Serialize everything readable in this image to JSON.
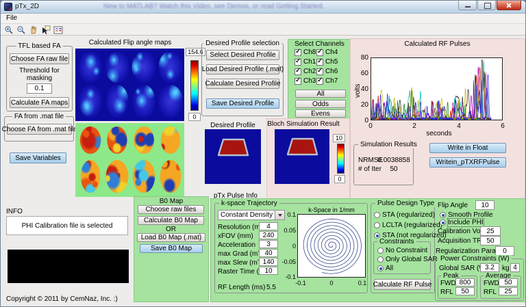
{
  "window": {
    "title": "pTx_2D",
    "watermark": "New to MATLAB? Watch this Video, see Demos, or read Getting Started."
  },
  "menu": {
    "file": "File"
  },
  "toolbar": {
    "icons": [
      "zoom-in",
      "zoom-out",
      "pan",
      "data-cursor",
      "legend"
    ]
  },
  "colors": {
    "panel_green": "#a5e39f",
    "panel_pink": "#f3e1df",
    "highlight_button_blue": "#aed3ee",
    "map_background_blue": "#0b0b9d",
    "phase_background_green": "#8de889",
    "profile_red": "#a81410",
    "titlebar_blue": "#cfdfee"
  },
  "left": {
    "tfl": {
      "legend": "TFL based FA",
      "choose_button": "Choose FA raw file",
      "threshold_label": "Threshold for masking",
      "threshold_value": "0.1",
      "calc_button": "Calculate FA maps"
    },
    "mat": {
      "legend": "FA from .mat file",
      "choose_button": "Choose FA from .mat file"
    },
    "save_button": "Save Variables",
    "info_label": "INFO",
    "info_text": "PHI Calibration file is selected",
    "copyright": "Copyright © 2011 by CemNaz, Inc. :)"
  },
  "flip_maps": {
    "title": "Calculated Flip angle maps",
    "cbar_max": "154.6",
    "cbar_min": "0"
  },
  "desired_selection": {
    "legend": "Desired Profile selection",
    "buttons": [
      "Select Desired Profile",
      "Load Desired Profile (.mat)",
      "Calculate Desired Profile"
    ],
    "save_button": "Save Desired Profile"
  },
  "channels": {
    "title": "Select Channels",
    "items": [
      {
        "label": "Ch8",
        "checked": true
      },
      {
        "label": "Ch4",
        "checked": true
      },
      {
        "label": "Ch1",
        "checked": true
      },
      {
        "label": "Ch5",
        "checked": true
      },
      {
        "label": "Ch2",
        "checked": true
      },
      {
        "label": "Ch6",
        "checked": true
      },
      {
        "label": "Ch3",
        "checked": true
      },
      {
        "label": "Ch7",
        "checked": true
      }
    ],
    "buttons": [
      "All",
      "Odds",
      "Evens"
    ]
  },
  "desired_profile": {
    "title": "Desired Profile"
  },
  "bloch": {
    "title": "Bloch Simulation Result",
    "cbar_max": "10",
    "cbar_min": "0"
  },
  "rf": {
    "title": "Calculated RF Pulses",
    "ylabel": "volts",
    "xlabel": "seconds",
    "yticks": [
      "80",
      "60",
      "40",
      "20",
      "0"
    ],
    "xticks": [
      "0",
      "2",
      "4",
      "6"
    ],
    "ylim": [
      0,
      80
    ],
    "xlim": [
      0,
      6
    ],
    "pulse_duration_s": 5.5,
    "series_colors": [
      "#00008f",
      "#c00000",
      "#007f00",
      "#00b8b8",
      "#b000b0",
      "#c8b400",
      "#303030",
      "#2828ff"
    ]
  },
  "sim_results": {
    "legend": "Simulation Results",
    "nrmse_label": "NRMSE",
    "nrmse_value": "0.0038858",
    "iter_label": "# of Iter",
    "iter_value": "50"
  },
  "write_buttons": {
    "float": "Write in Float",
    "ptx": "Writein_pTXRFPulse"
  },
  "b0": {
    "title": "B0 Map",
    "choose_button": "Choose raw files",
    "calc_button": "Calculate B0 Map",
    "or_label": "OR",
    "load_button": "Load B0 Map (.mat)",
    "save_button": "Save B0 Map"
  },
  "pulse_info": {
    "title": "pTx Pulse Info",
    "kspace": {
      "legend": "k-space Trajectory",
      "dropdown": "Constant Density Spiral",
      "params": [
        {
          "label": "Resolution (mm)",
          "value": "4"
        },
        {
          "label": "xFOV (mm)",
          "value": "240"
        },
        {
          "label": "Acceleration",
          "value": "3"
        },
        {
          "label": "max Grad (mT/m)",
          "value": "40"
        },
        {
          "label": "max Slew (mT/m/s)",
          "value": "140"
        },
        {
          "label": "Raster Time (us)",
          "value": "10"
        }
      ],
      "rf_length_label": "RF Length (ms)",
      "rf_length_value": "5.5",
      "plot_title": "k-Space in 1/mm",
      "yticks": [
        "0.1",
        "0.05",
        "0",
        "-0.05",
        "-0.1"
      ],
      "xticks": [
        "-0.1",
        "0",
        "0.1"
      ]
    },
    "design": {
      "legend": "Pulse Design Type",
      "options": [
        {
          "label": "STA (regularized)",
          "selected": false
        },
        {
          "label": "LCLTA (regularized)",
          "selected": false
        },
        {
          "label": "STA (not regularized)",
          "selected": true
        }
      ],
      "constraints_legend": "Constraints",
      "constraints": [
        {
          "label": "No Constraint",
          "selected": false
        },
        {
          "label": "Only Global SAR",
          "selected": false
        },
        {
          "label": "All",
          "selected": true
        }
      ],
      "calc_button": "Calculate RF Pulse"
    },
    "settings": {
      "flip_label": "Flip Angle",
      "flip_value": "10",
      "smooth_label": "Smooth Profile",
      "smooth_selected": true,
      "phi_label": "Include PHI",
      "phi_selected": true,
      "calib_label": "Calibration Voltage",
      "calib_value": "25",
      "tr_label": "Acquisition TR (ms)",
      "tr_value": "50",
      "reg_label": "Regularization Parameter",
      "reg_value": "0",
      "power_legend": "Power Constraints (W)",
      "gsar_label": "Global SAR (W/kg)",
      "gsar_value": "3.2",
      "kg_label": "kg",
      "kg_value": "4",
      "peak_legend": "Peak",
      "avg_legend": "Average",
      "fwd_label": "FWD",
      "rfl_label": "RFL",
      "peak_fwd": "800",
      "peak_rfl": "50",
      "avg_fwd": "50",
      "avg_rfl": "25"
    }
  }
}
